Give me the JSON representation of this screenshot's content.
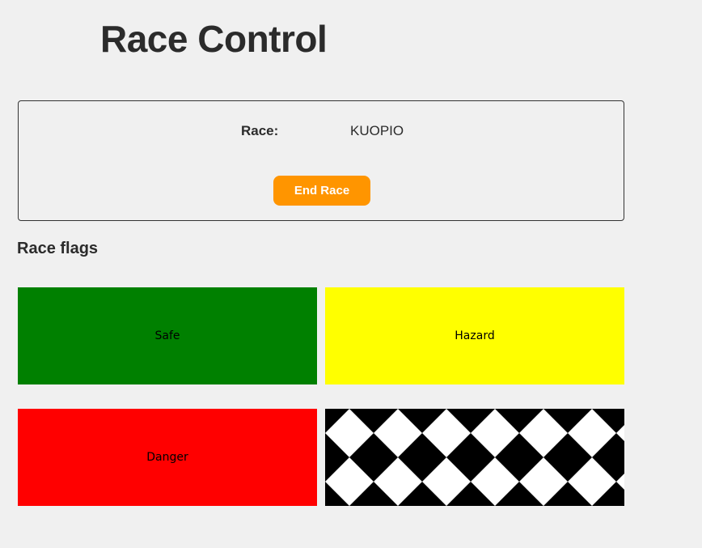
{
  "header": {
    "title": "Race Control"
  },
  "race": {
    "label": "Race:",
    "name": "KUOPIO",
    "end_button_label": "End Race"
  },
  "flags_section": {
    "heading": "Race flags",
    "flags": [
      {
        "label": "Safe",
        "color": "#008000"
      },
      {
        "label": "Hazard",
        "color": "#ffff00"
      },
      {
        "label": "Danger",
        "color": "#ff0000"
      },
      {
        "label": "",
        "pattern": "checkered",
        "colors": [
          "#000000",
          "#ffffff"
        ]
      }
    ]
  },
  "colors": {
    "accent": "#ff9500",
    "background": "#f0f0f0"
  }
}
